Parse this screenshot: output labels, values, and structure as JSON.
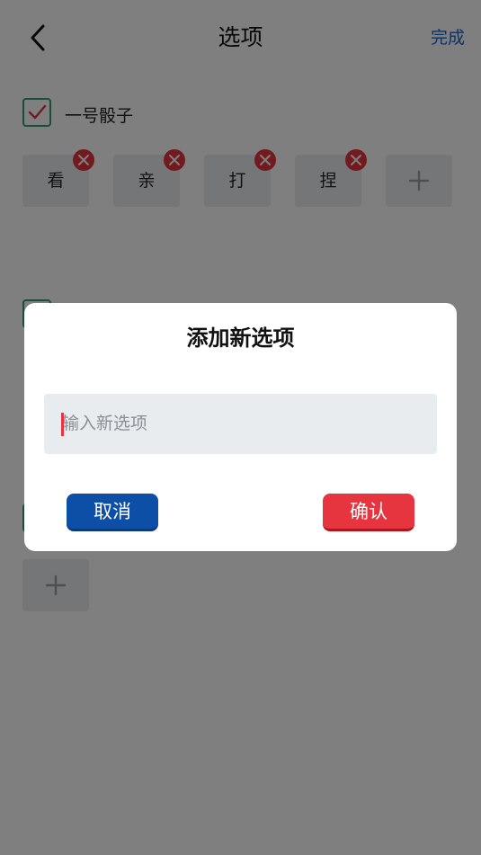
{
  "header": {
    "title": "选项",
    "done_label": "完成"
  },
  "groups": [
    {
      "name": "一号骰子",
      "checked": true,
      "options": [
        "看",
        "亲",
        "打",
        "捏"
      ]
    }
  ],
  "dialog": {
    "title": "添加新选项",
    "input_placeholder": "输入新选项",
    "cancel_label": "取消",
    "confirm_label": "确认"
  },
  "colors": {
    "accent_blue": "#1d63c9",
    "checkbox_green": "#2fa06b",
    "delete_red": "#e6353f",
    "cancel_button": "#0d4fa6",
    "confirm_button": "#e6353f",
    "chip_bg": "#e9ecee"
  }
}
